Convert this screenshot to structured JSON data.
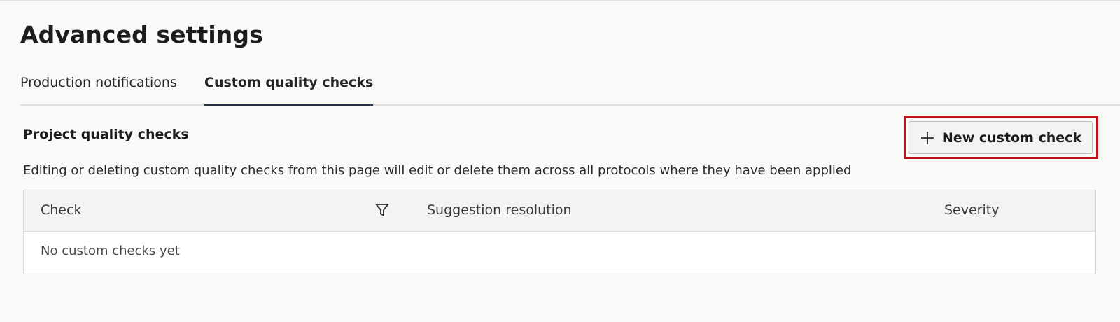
{
  "page": {
    "title": "Advanced settings"
  },
  "tabs": [
    {
      "label": "Production notifications",
      "active": false
    },
    {
      "label": "Custom quality checks",
      "active": true
    }
  ],
  "section": {
    "title": "Project quality checks",
    "description": "Editing or deleting custom quality checks from this page will edit or delete them across all protocols where they have been applied",
    "new_button_label": "New custom check",
    "new_button_icon": "plus-icon"
  },
  "table": {
    "columns": [
      "Check",
      "Suggestion resolution",
      "Severity"
    ],
    "filter_icon": "filter-icon",
    "rows": [],
    "empty_message": "No custom checks yet"
  },
  "colors": {
    "highlight": "#c0141d",
    "tab_underline": "#1e3147"
  }
}
